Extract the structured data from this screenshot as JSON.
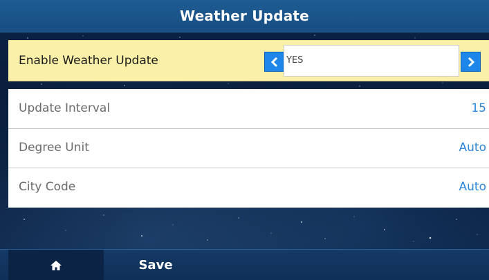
{
  "header": {
    "title": "Weather Update"
  },
  "enable_row": {
    "label": "Enable Weather Update",
    "value": "YES",
    "prev_icon": "chevron-left-icon",
    "next_icon": "chevron-right-icon"
  },
  "settings": [
    {
      "label": "Update Interval",
      "value": "15"
    },
    {
      "label": "Degree Unit",
      "value": "Auto"
    },
    {
      "label": "City Code",
      "value": "Auto"
    }
  ],
  "bottom_bar": {
    "home_icon": "home-icon",
    "save_label": "Save"
  },
  "colors": {
    "title_bar": "#1e5c93",
    "selected_row": "#fbf0a8",
    "accent_blue": "#1e86e8",
    "value_text": "#2b86d9",
    "background": "#0a1a33"
  }
}
